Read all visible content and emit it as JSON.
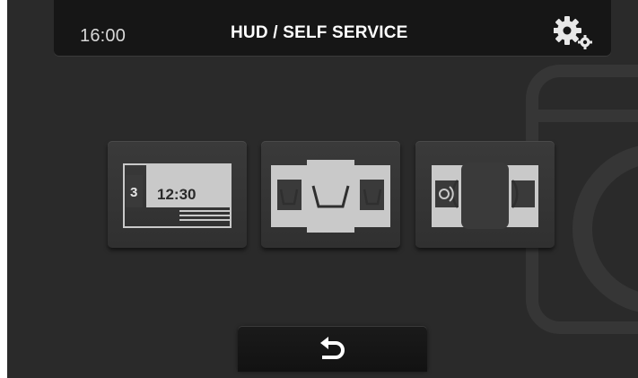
{
  "header": {
    "time": "16:00",
    "title": "HUD / SELF SERVICE",
    "settings_icon": "gears-icon"
  },
  "programs": [
    {
      "id": "schedule",
      "icon": "schedule-display-icon",
      "number": "3",
      "time": "12:30"
    },
    {
      "id": "wash",
      "icon": "wash-tubs-icon"
    },
    {
      "id": "dry",
      "icon": "dryer-drum-icon"
    }
  ],
  "footer": {
    "back_icon": "back-arrow-icon"
  },
  "colors": {
    "background": "#2a2a2a",
    "header": "#161616",
    "button": "#353535",
    "icon": "#c9c9c9",
    "text": "#ffffff"
  }
}
